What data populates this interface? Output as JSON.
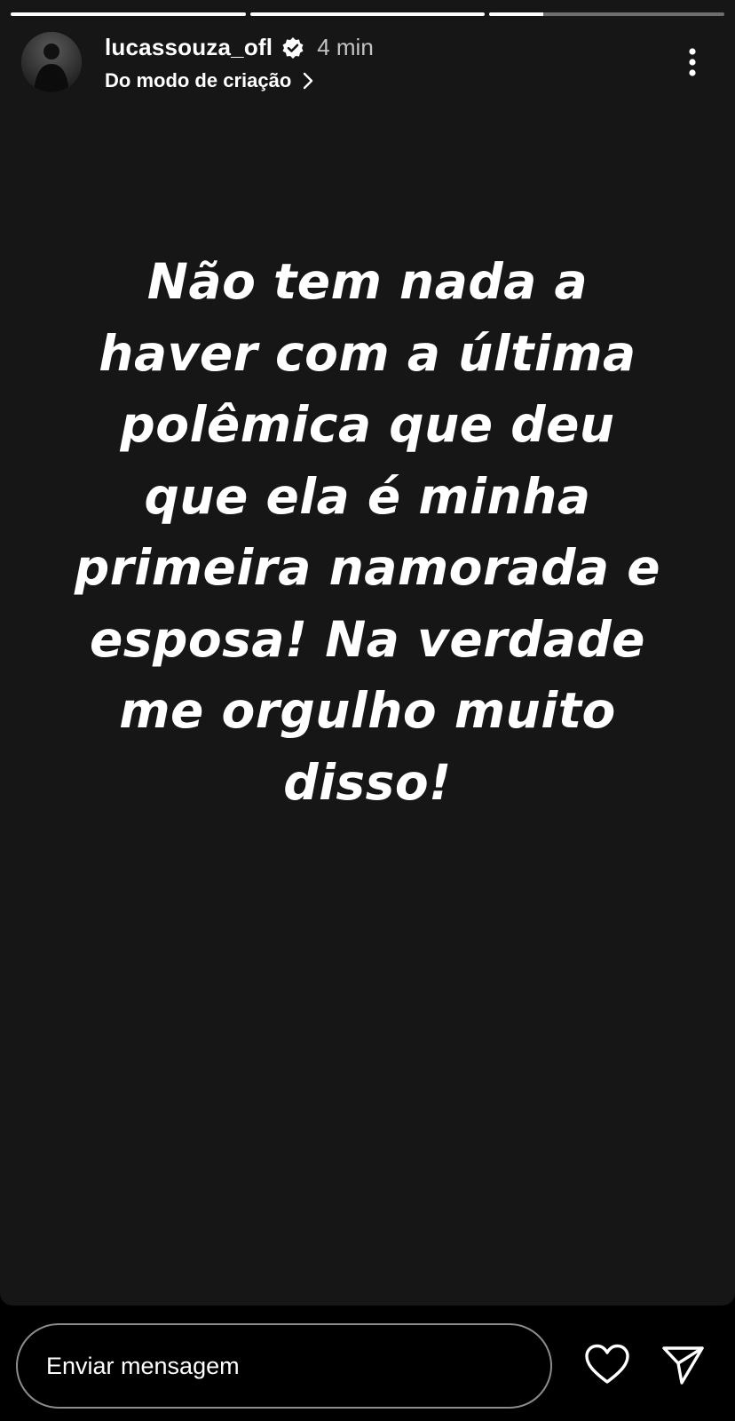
{
  "progress": [
    1.0,
    1.0,
    0.23
  ],
  "header": {
    "username": "lucassouza_ofl",
    "time": "4 min",
    "subtitle": "Do modo de criação"
  },
  "story": {
    "lines": [
      "Não tem nada a",
      "haver com a última",
      "polêmica que deu",
      "que ela é minha",
      "primeira namorada e",
      "esposa! Na verdade",
      "me orgulho muito",
      "disso!"
    ]
  },
  "reply": {
    "placeholder": "Enviar mensagem"
  },
  "icons": {
    "verified": "verified-badge-icon",
    "subtitle_chevron": "chevron-right-icon",
    "more": "more-vertical-icon",
    "like": "heart-icon",
    "share": "send-icon"
  },
  "colors": {
    "story_background": "#161616",
    "app_background": "#000000",
    "text": "#ffffff"
  }
}
